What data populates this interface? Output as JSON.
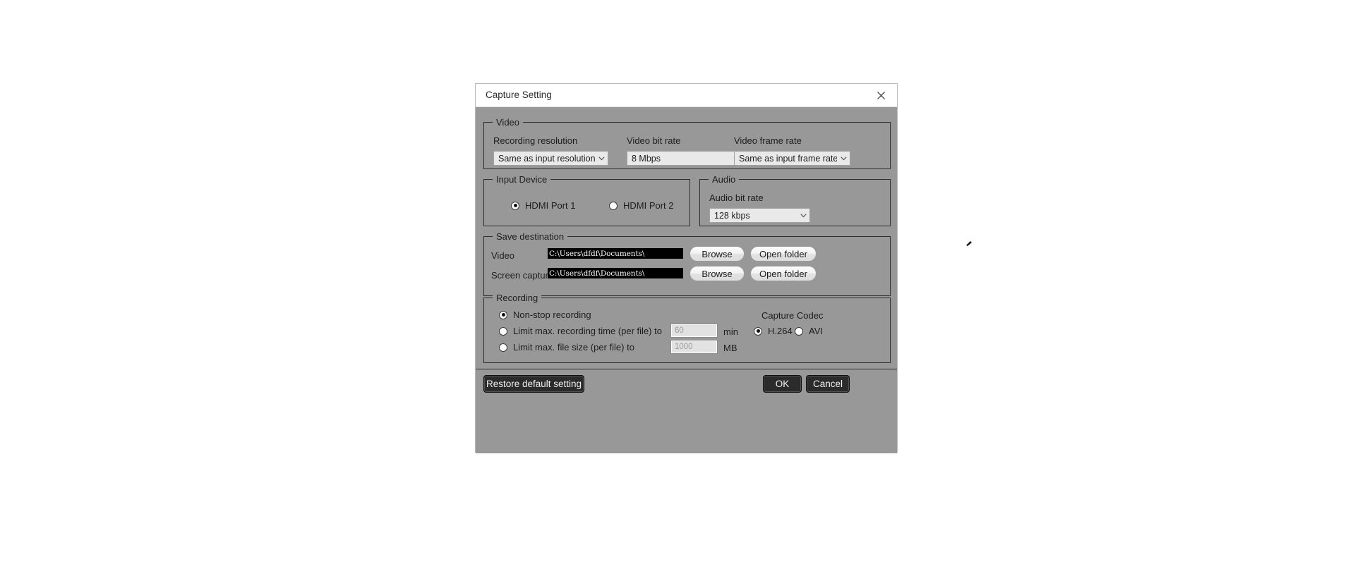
{
  "window": {
    "title": "Capture Setting",
    "close_icon": "close-icon"
  },
  "video_group": {
    "title": "Video",
    "recording_resolution": {
      "label": "Recording resolution",
      "value": "Same as input resolution"
    },
    "video_bit_rate": {
      "label": "Video bit rate",
      "value": "8 Mbps"
    },
    "video_frame_rate": {
      "label": "Video frame rate",
      "value": "Same as input frame rate"
    }
  },
  "input_device_group": {
    "title": "Input Device",
    "options": [
      {
        "label": "HDMI Port 1",
        "selected": true
      },
      {
        "label": "HDMI Port 2",
        "selected": false
      }
    ]
  },
  "audio_group": {
    "title": "Audio",
    "audio_bit_rate": {
      "label": "Audio bit rate",
      "value": "128 kbps"
    }
  },
  "save_destination_group": {
    "title": "Save destination",
    "rows": [
      {
        "label": "Video",
        "path": "C:\\Users\\dfdf\\Documents\\",
        "browse_label": "Browse",
        "open_folder_label": "Open folder"
      },
      {
        "label": "Screen capture",
        "path": "C:\\Users\\dfdf\\Documents\\",
        "browse_label": "Browse",
        "open_folder_label": "Open folder"
      }
    ]
  },
  "recording_group": {
    "title": "Recording",
    "mode_options": [
      {
        "label": "Non-stop recording",
        "selected": true
      },
      {
        "label": "Limit max. recording time (per file) to",
        "selected": false
      },
      {
        "label": "Limit max. file size (per file) to",
        "selected": false
      }
    ],
    "time_limit": {
      "value": "60",
      "unit": "min"
    },
    "size_limit": {
      "value": "1000",
      "unit": "MB"
    },
    "capture_codec": {
      "label": "Capture Codec",
      "options": [
        {
          "label": "H.264",
          "selected": true
        },
        {
          "label": "AVI",
          "selected": false
        }
      ]
    }
  },
  "footer": {
    "restore_label": "Restore default setting",
    "ok_label": "OK",
    "cancel_label": "Cancel"
  },
  "colors": {
    "dialog_bg": "#989898",
    "titlebar_bg": "#ffffff",
    "group_border": "#2e2e2e",
    "field_bg": "#e9e9e9",
    "selected_field_bg": "#000000",
    "dark_button_bg": "#2b2b2b"
  }
}
